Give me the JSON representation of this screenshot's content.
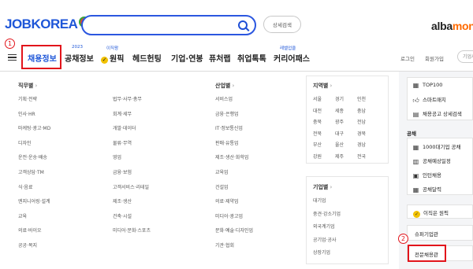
{
  "header": {
    "logo": "JOBKOREA",
    "search": {
      "value": "",
      "placeholder": ""
    },
    "adv_search": "상세검색",
    "albamon_prefix": "alba",
    "albamon_suffix": "mon"
  },
  "nav": {
    "items": [
      {
        "label": "채용정보",
        "sup": ""
      },
      {
        "label": "공채정보",
        "sup": "2023"
      },
      {
        "label": "원픽",
        "sup": "이직왕"
      },
      {
        "label": "헤드헌팅",
        "sup": ""
      },
      {
        "label": "기업·연봉",
        "sup": ""
      },
      {
        "label": "퓨처랩",
        "sup": ""
      },
      {
        "label": "취업톡톡",
        "sup": ""
      },
      {
        "label": "커리어패스",
        "sup": "레벨업클"
      }
    ],
    "login": "로그인",
    "signup": "회원가입",
    "company_search": "기업서비스"
  },
  "annotations": {
    "one": "1",
    "two": "2"
  },
  "menu": {
    "job": {
      "title": "직무별",
      "col1": [
        "기획·전략",
        "인사·HR",
        "마케팅·광고·MD",
        "디자인",
        "운전·운송·배송",
        "고객상담·TM",
        "식·음료",
        "엔지니어링·설계",
        "교육",
        "의료·바이오",
        "공공·복지"
      ],
      "col2": [
        "법무·사무·총무",
        "회계·세무",
        "개발·데이터",
        "물류·무역",
        "영업",
        "금융·보험",
        "고객서비스·리테일",
        "제조·생산",
        "건축·시설",
        "미디어·문화·스포츠"
      ]
    },
    "industry": {
      "title": "산업별",
      "items": [
        "서비스업",
        "금융·은행업",
        "IT·정보통신업",
        "판매·유통업",
        "제조·생산·화학업",
        "교육업",
        "건설업",
        "의료·제약업",
        "미디어·광고업",
        "문화·예술·디자인업",
        "기관·협회"
      ]
    },
    "region": {
      "title": "지역별",
      "cells": [
        "서울",
        "경기",
        "인천",
        "대전",
        "세종",
        "충남",
        "충북",
        "광주",
        "전남",
        "전북",
        "대구",
        "경북",
        "부산",
        "울산",
        "경남",
        "강원",
        "제주",
        "전국"
      ]
    },
    "company": {
      "title": "기업별",
      "items": [
        "대기업",
        "중견·강소기업",
        "외국계기업",
        "공기업·공사",
        "상장기업"
      ]
    }
  },
  "side": {
    "top": [
      "TOP100",
      "스마트매치",
      "채용공고 상세검색"
    ],
    "gongchae_title": "공채",
    "gongchae": [
      "1000대기업 공채",
      "공채예상일정",
      "인턴채용",
      "공채달력"
    ],
    "wonpick": "이직은 원픽",
    "headhunting": "슈퍼기업관",
    "pro": "전문채용관"
  }
}
